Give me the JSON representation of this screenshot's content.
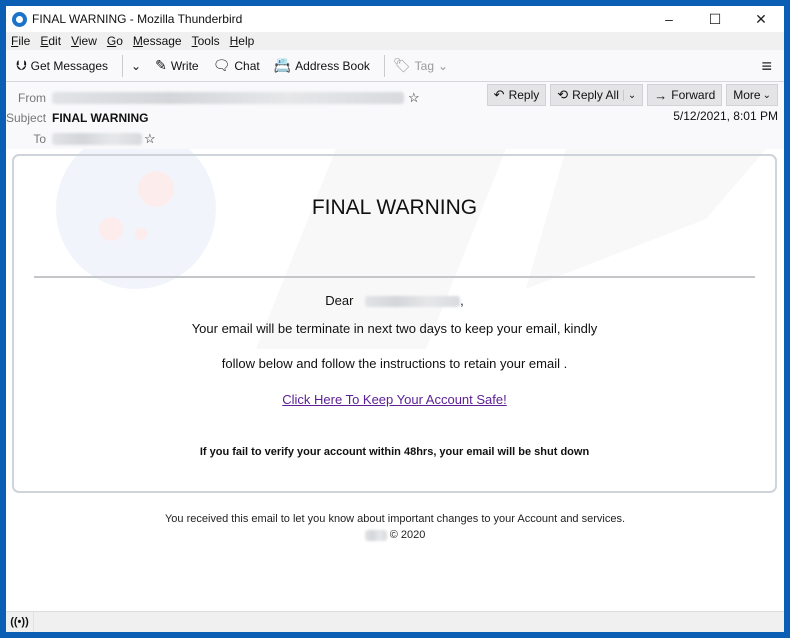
{
  "window": {
    "title": "FINAL WARNING - Mozilla Thunderbird",
    "controls": {
      "minimize": "–",
      "maximize": "☐",
      "close": "✕"
    }
  },
  "menu": [
    "File",
    "Edit",
    "View",
    "Go",
    "Message",
    "Tools",
    "Help"
  ],
  "toolbar": {
    "get_messages": "Get Messages",
    "write": "Write",
    "chat": "Chat",
    "address_book": "Address Book",
    "tag": "Tag",
    "icons": {
      "get_messages": "⮋",
      "dropdown": "⌄",
      "write": "✎",
      "chat": "🗨",
      "address_book": "📇",
      "tag": "🏷",
      "menu": "≡"
    }
  },
  "header": {
    "from_label": "From",
    "subject_label": "Subject",
    "subject": "FINAL WARNING",
    "to_label": "To",
    "date": "5/12/2021, 8:01 PM",
    "star": "☆",
    "actions": {
      "reply": "Reply",
      "reply_all": "Reply All",
      "forward": "Forward",
      "more": "More"
    },
    "action_icons": {
      "reply": "↶",
      "reply_all": "⟲",
      "forward": "→",
      "chevron": "⌄"
    }
  },
  "email": {
    "title": "FINAL WARNING",
    "greeting": "Dear",
    "greeting_suffix": ",",
    "line1": "Your email will be terminate in next two days to keep your email, kindly",
    "line2": "follow below and follow the instructions to retain your email .",
    "link_text": "Click Here To Keep Your Account Safe!",
    "warning": "If you fail to verify your account within 48hrs, your email will be shut down",
    "footer_line1": "You received this email to let you know about important changes to your Account and services.",
    "footer_copyright": "© 2020",
    "link_color": "#5b1e95"
  },
  "statusbar": {
    "icon": "((•))"
  }
}
